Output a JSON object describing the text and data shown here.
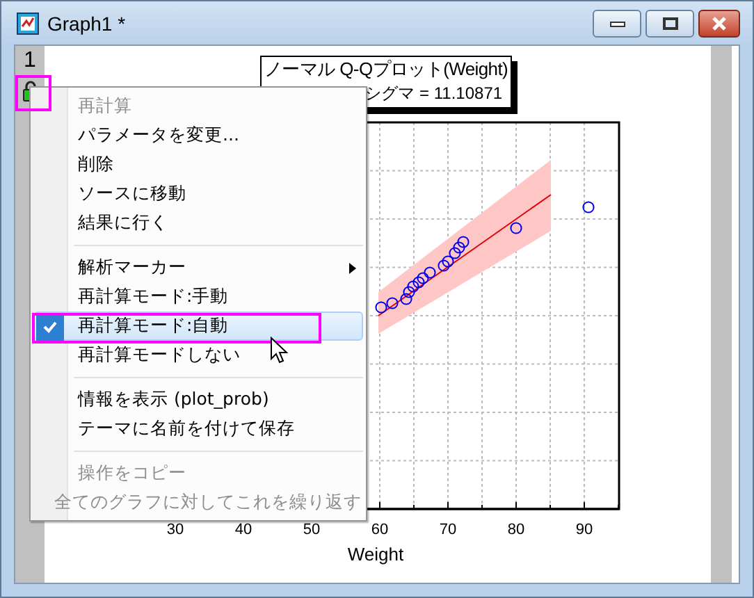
{
  "window": {
    "title": "Graph1 *"
  },
  "layer_tab": {
    "label": "1"
  },
  "graph": {
    "title_lines": [
      "ノーマル Q-Qプロット(Weight)",
      "シグマ = 11.10871"
    ],
    "x_axis": {
      "ticks": [
        "30",
        "40",
        "50",
        "60",
        "70",
        "80",
        "90"
      ],
      "label": "Weight"
    }
  },
  "context_menu": {
    "items": [
      {
        "kind": "item",
        "label": "再計算",
        "disabled": true,
        "checked": false,
        "selected": false,
        "submenu": false
      },
      {
        "kind": "item",
        "label": "パラメータを変更...",
        "disabled": false,
        "checked": false,
        "selected": false,
        "submenu": false
      },
      {
        "kind": "item",
        "label": "削除",
        "disabled": false,
        "checked": false,
        "selected": false,
        "submenu": false
      },
      {
        "kind": "item",
        "label": "ソースに移動",
        "disabled": false,
        "checked": false,
        "selected": false,
        "submenu": false
      },
      {
        "kind": "item",
        "label": "結果に行く",
        "disabled": false,
        "checked": false,
        "selected": false,
        "submenu": false
      },
      {
        "kind": "separator"
      },
      {
        "kind": "item",
        "label": "解析マーカー",
        "disabled": false,
        "checked": false,
        "selected": false,
        "submenu": true
      },
      {
        "kind": "item",
        "label": "再計算モード:手動",
        "disabled": false,
        "checked": false,
        "selected": false,
        "submenu": false
      },
      {
        "kind": "item",
        "label": "再計算モード:自動",
        "disabled": false,
        "checked": true,
        "selected": true,
        "submenu": false
      },
      {
        "kind": "item",
        "label": "再計算モードしない",
        "disabled": false,
        "checked": false,
        "selected": false,
        "submenu": false
      },
      {
        "kind": "separator"
      },
      {
        "kind": "item",
        "label": "情報を表示 (plot_prob)",
        "disabled": false,
        "checked": false,
        "selected": false,
        "submenu": false
      },
      {
        "kind": "item",
        "label": "テーマに名前を付けて保存",
        "disabled": false,
        "checked": false,
        "selected": false,
        "submenu": false
      },
      {
        "kind": "separator"
      },
      {
        "kind": "item",
        "label": "操作をコピー",
        "disabled": true,
        "checked": false,
        "selected": false,
        "submenu": false
      },
      {
        "kind": "item",
        "label": "全てのグラフに対してこれを繰り返す",
        "disabled": true,
        "checked": false,
        "selected": false,
        "submenu": false
      }
    ]
  }
}
